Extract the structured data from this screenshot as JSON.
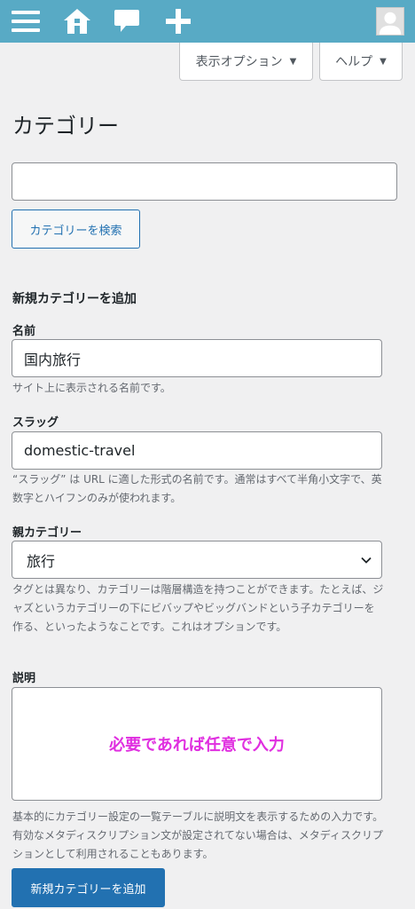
{
  "adminbar": {
    "icons": [
      "menu-icon",
      "home-icon",
      "comment-icon",
      "plus-icon",
      "avatar"
    ]
  },
  "screen_meta": {
    "options_label": "表示オプション",
    "help_label": "ヘルプ"
  },
  "page": {
    "title": "カテゴリー"
  },
  "search": {
    "value": "",
    "button_label": "カテゴリーを検索"
  },
  "add_form": {
    "heading": "新規カテゴリーを追加",
    "name": {
      "label": "名前",
      "value": "国内旅行",
      "help": "サイト上に表示される名前です。"
    },
    "slug": {
      "label": "スラッグ",
      "value": "domestic-travel",
      "help": "“スラッグ” は URL に適した形式の名前です。通常はすべて半角小文字で、英数字とハイフンのみが使われます。"
    },
    "parent": {
      "label": "親カテゴリー",
      "selected": "旅行",
      "help": "タグとは異なり、カテゴリーは階層構造を持つことができます。たとえば、ジャズというカテゴリーの下にビバップやビッグバンドという子カテゴリーを作る、といったようなことです。これはオプションです。"
    },
    "description": {
      "label": "説明",
      "overlay_text": "必要であれば任意で入力",
      "help": "基本的にカテゴリー設定の一覧テーブルに説明文を表示するための入力です。有効なメタディスクリプション文が設定されてない場合は、メタディスクリプションとして利用されることもあります。"
    },
    "submit_label": "新規カテゴリーを追加"
  },
  "colors": {
    "adminbar": "#58aac5",
    "primary": "#2271b1",
    "annotation": "#e02fe0",
    "background": "#f0f0f1"
  }
}
